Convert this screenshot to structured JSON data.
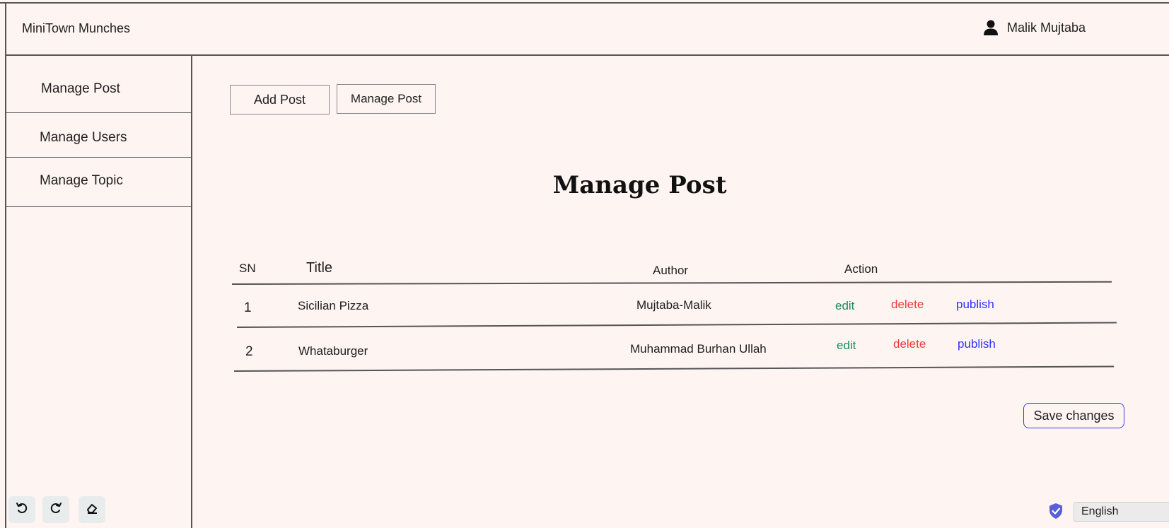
{
  "header": {
    "brand": "MiniTown Munches",
    "user_name": "Malik Mujtaba"
  },
  "sidebar": {
    "items": [
      {
        "label": "Manage Post"
      },
      {
        "label": "Manage Users"
      },
      {
        "label": "Manage Topic"
      }
    ]
  },
  "toolbar": {
    "add_post_label": "Add Post",
    "manage_post_label": "Manage Post"
  },
  "main": {
    "title": "Manage Post"
  },
  "table": {
    "headers": {
      "sn": "SN",
      "title": "Title",
      "author": "Author",
      "action": "Action"
    },
    "rows": [
      {
        "sn": "1",
        "title": "Sicilian Pizza",
        "author": "Mujtaba-Malik"
      },
      {
        "sn": "2",
        "title": "Whataburger",
        "author": "Muhammad Burhan Ullah"
      }
    ],
    "actions": {
      "edit": "edit",
      "delete": "delete",
      "publish": "publish"
    }
  },
  "footer": {
    "save_label": "Save changes",
    "language": "English"
  },
  "colors": {
    "background": "#fef4f2",
    "edit": "#1f8a5a",
    "delete": "#ee3b3b",
    "publish": "#2f32ff",
    "accent": "#3b3bd6"
  },
  "icons": {
    "user": "user-icon",
    "undo": "undo-icon",
    "redo": "redo-icon",
    "eraser": "eraser-icon",
    "shield": "shield-icon"
  }
}
